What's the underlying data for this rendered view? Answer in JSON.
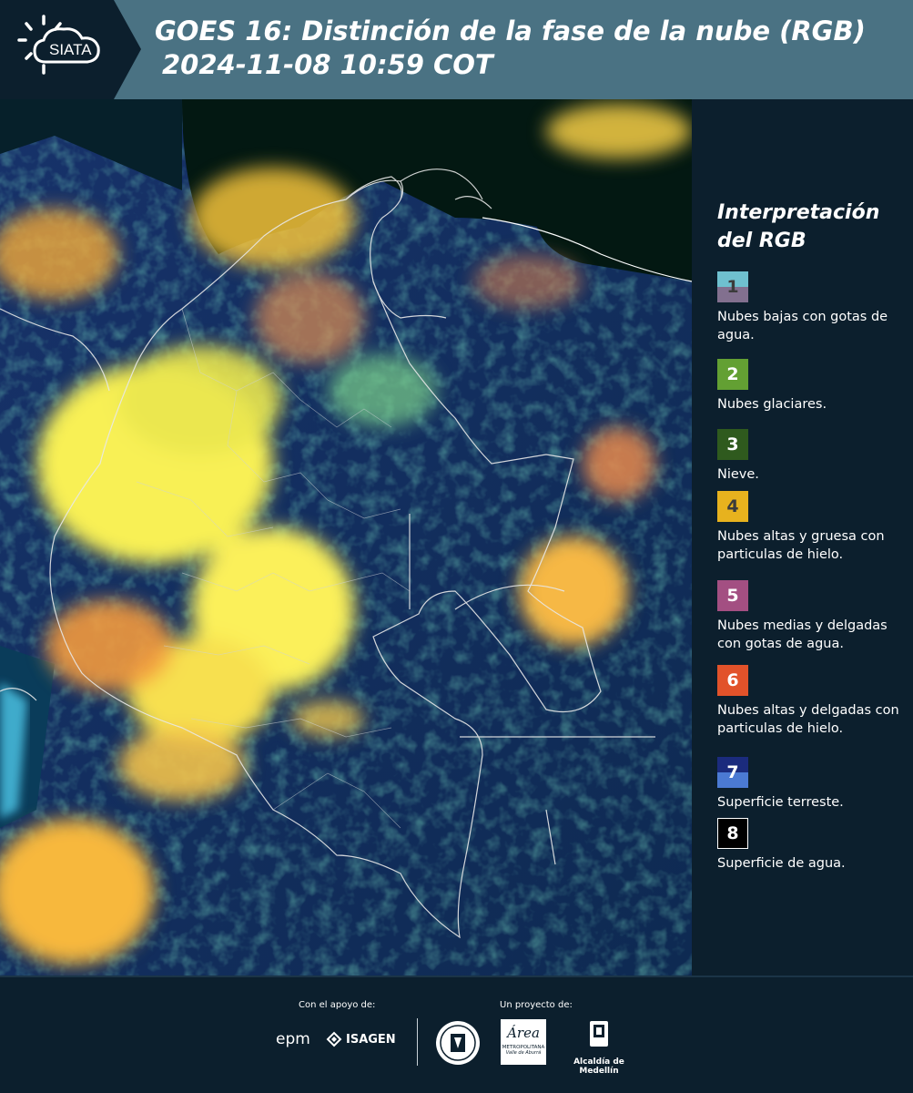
{
  "header": {
    "logo_text": "SIATA",
    "title_line1": "GOES 16: Distinción de la fase de la nube (RGB)",
    "title_line2": "2024-11-08 10:59 COT",
    "colors": {
      "header_bg": "#4a7283",
      "logo_bg": "#0c1f2d"
    }
  },
  "legend": {
    "title_line1": "Interpretación",
    "title_line2": "del RGB",
    "items": [
      {
        "number": "1",
        "label": "Nubes bajas con gotas de agua.",
        "color_top": "#6fc0cf",
        "color_bottom": "#82708f"
      },
      {
        "number": "2",
        "label": "Nubes glaciares.",
        "color_top": "#63a033",
        "color_bottom": "#63a033"
      },
      {
        "number": "3",
        "label": "Nieve.",
        "color_top": "#2f5a1e",
        "color_bottom": "#2f5a1e"
      },
      {
        "number": "4",
        "label": "Nubes altas y gruesa con particulas de hielo.",
        "color_top": "#e7b21e",
        "color_bottom": "#e7b21e"
      },
      {
        "number": "5",
        "label": "Nubes medias y delgadas con gotas de agua.",
        "color_top": "#a34f82",
        "color_bottom": "#a34f82"
      },
      {
        "number": "6",
        "label": "Nubes altas y delgadas con particulas de hielo.",
        "color_top": "#e2522a",
        "color_bottom": "#e2522a"
      },
      {
        "number": "7",
        "label": "Superficie terreste.",
        "color_top": "#1b2b7d",
        "color_bottom": "#4b7ad3"
      },
      {
        "number": "8",
        "label": "Superficie de agua.",
        "color_top": "#000000",
        "color_bottom": "#000000"
      }
    ]
  },
  "footer": {
    "support_label": "Con el apoyo de:",
    "project_label": "Un proyecto de:",
    "epm_text": "epm",
    "isagen_text": "ISAGEN",
    "area_text": "Área",
    "area_sub": "METROPOLITANA",
    "area_sub2": "Valle de Aburrá",
    "alcaldia_text": "Alcaldía de Medellín"
  }
}
